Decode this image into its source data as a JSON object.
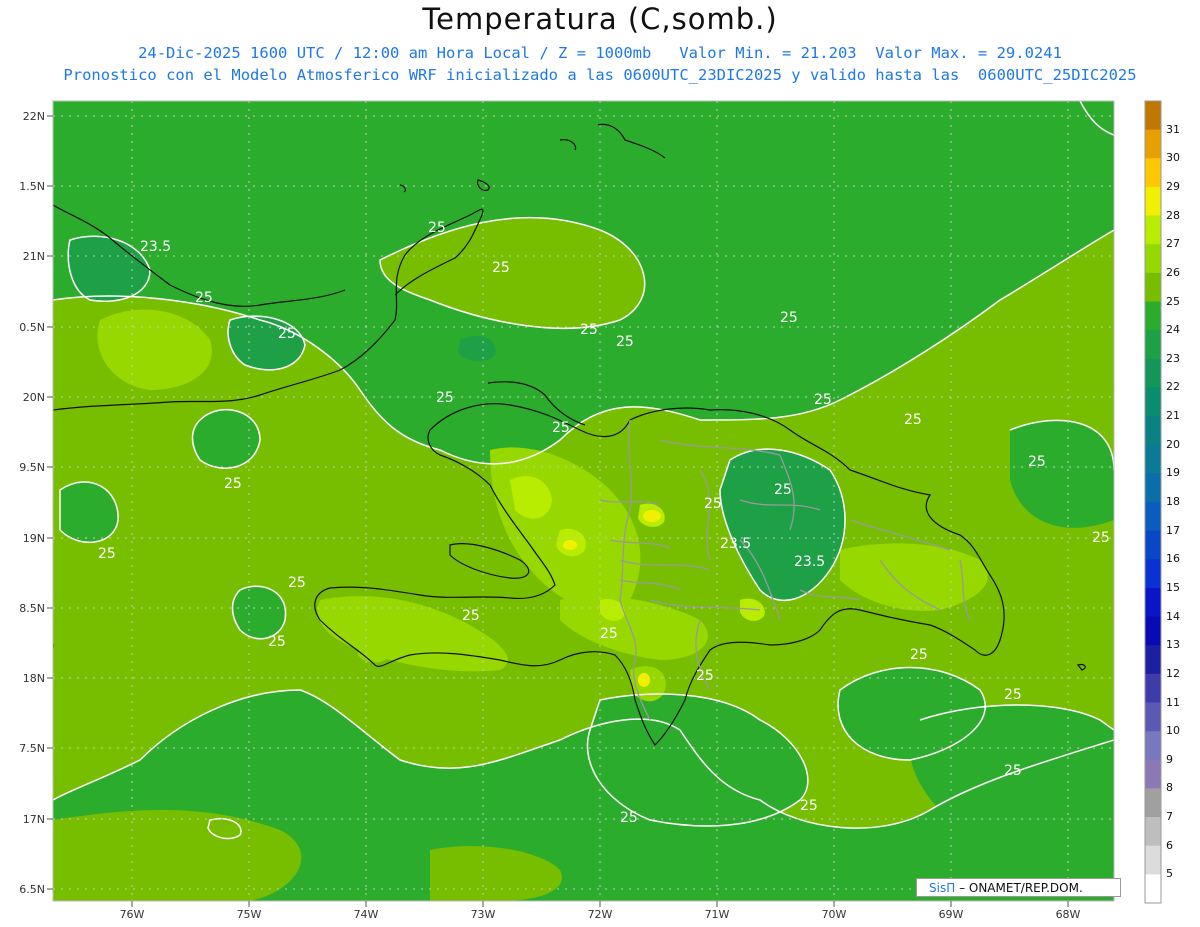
{
  "header": {
    "title": "Temperatura (C,somb.)",
    "line1": "24-Dic-2025 1600 UTC / 12:00 am Hora Local / Z = 1000mb   Valor Min. = 21.203  Valor Max. = 29.0241",
    "line2": "Pronostico con el Modelo Atmosferico WRF inicializado a las 0600UTC_23DIC2025 y valido hasta las  0600UTC_25DIC2025"
  },
  "axes": {
    "lat_labels": [
      "22N",
      "1.5N",
      "21N",
      "0.5N",
      "20N",
      "9.5N",
      "19N",
      "8.5N",
      "18N",
      "7.5N",
      "17N",
      "6.5N"
    ],
    "lon_labels": [
      "76W",
      "75W",
      "74W",
      "73W",
      "72W",
      "71W",
      "70W",
      "69W",
      "68W"
    ]
  },
  "colorbar": {
    "values": [
      "31",
      "30",
      "29",
      "28",
      "27",
      "26",
      "25",
      "24",
      "23",
      "22",
      "21",
      "20",
      "19",
      "18",
      "17",
      "16",
      "15",
      "14",
      "13",
      "12",
      "11",
      "10",
      "9",
      "8",
      "7",
      "6",
      "5"
    ],
    "colors": [
      "#c07800",
      "#e8a000",
      "#ffc800",
      "#f0f000",
      "#b8ec00",
      "#96d800",
      "#78be00",
      "#2cac2c",
      "#1ea046",
      "#14965a",
      "#0a8c6e",
      "#0a8282",
      "#0a7a96",
      "#0a6eaa",
      "#0a5cbe",
      "#0a46c8",
      "#0a32d2",
      "#0a14c8",
      "#0a0ab4",
      "#1e1ea0",
      "#3c3caa",
      "#5a5ab4",
      "#7878be",
      "#8c78b4",
      "#a0a0a0",
      "#bebebe",
      "#dcdcdc",
      "#ffffff"
    ]
  },
  "contour_labels": [
    "25",
    "23.5"
  ],
  "credit": {
    "brand": "SisΠ",
    "text": "– ONAMET/REP.DOM."
  }
}
